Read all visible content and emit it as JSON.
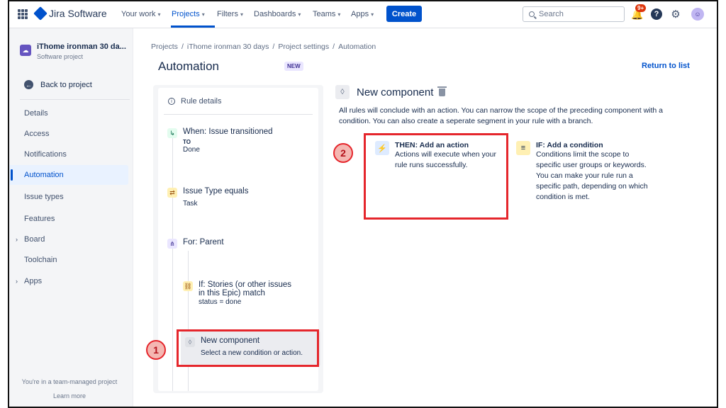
{
  "topnav": {
    "product": "Jira Software",
    "items": [
      "Your work",
      "Projects",
      "Filters",
      "Dashboards",
      "Teams",
      "Apps"
    ],
    "create_label": "Create",
    "search_placeholder": "Search",
    "notification_badge": "9+",
    "help_label": "?"
  },
  "sidebar": {
    "project_name": "iThome ironman 30 da...",
    "project_type": "Software project",
    "back_label": "Back to project",
    "items": [
      "Details",
      "Access",
      "Notifications",
      "Automation",
      "Issue types",
      "Features",
      "Board",
      "Toolchain",
      "Apps"
    ],
    "footer_text": "You're in a team-managed project",
    "learn_more": "Learn more"
  },
  "breadcrumb": [
    "Projects",
    "iThome ironman 30 days",
    "Project settings",
    "Automation"
  ],
  "page": {
    "title": "Automation",
    "lozenge": "NEW",
    "return_link": "Return to list"
  },
  "rule": {
    "details_label": "Rule details",
    "trigger_title": "When: Issue transitioned",
    "trigger_to_label": "TO",
    "trigger_to_value": "Done",
    "condition_title": "Issue Type equals",
    "condition_value": "Task",
    "branch_title": "For: Parent",
    "if_title_line1": "If: Stories (or other issues",
    "if_title_line2": "in this Epic) match",
    "if_value": "status = done",
    "new_component_title": "New component",
    "new_component_sub": "Select a new condition or action."
  },
  "component": {
    "title": "New component",
    "description": "All rules will conclude with an action. You can narrow the scope of the preceding component with a condition. You can also create a seperate segment in your rule with a branch.",
    "then_title": "THEN: Add an action",
    "then_desc": "Actions will execute when your rule runs successfully.",
    "if_title": "IF: Add a condition",
    "if_desc": "Conditions limit the scope to specific user groups or keywords. You can make your rule run a specific path, depending on which condition is met."
  },
  "annotations": [
    "1",
    "2"
  ],
  "colors": {
    "accent": "#0052CC",
    "highlight": "#E5262C",
    "marker_fill": "#F4B7B2"
  }
}
